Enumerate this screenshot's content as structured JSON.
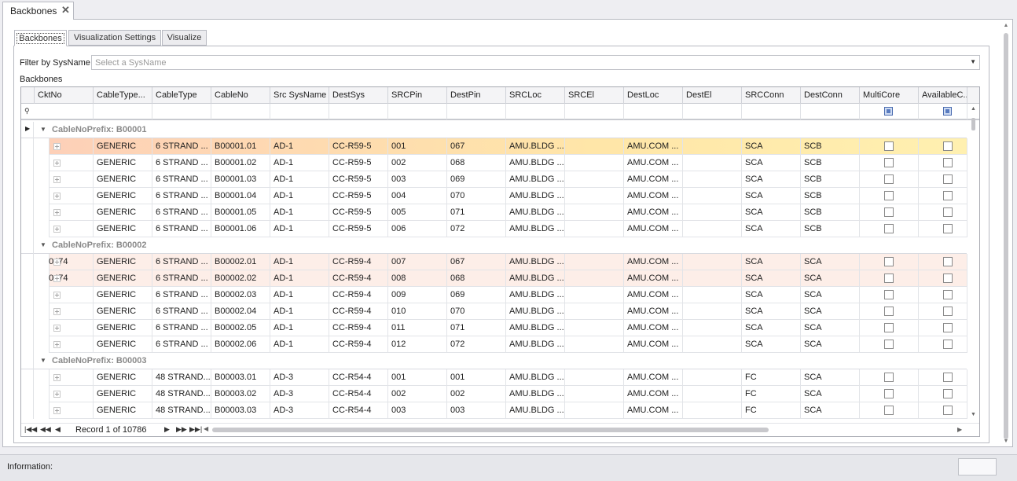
{
  "doc_tab": {
    "label": "Backbones",
    "close_glyph": "✕"
  },
  "inner_tabs": [
    {
      "label": "Backbones",
      "active": true
    },
    {
      "label": "Visualization Settings",
      "active": false
    },
    {
      "label": "Visualize",
      "active": false
    }
  ],
  "filter": {
    "label": "Filter by SysName",
    "placeholder": "Select a SysName"
  },
  "grid_caption": "Backbones",
  "columns": [
    "CktNo",
    "CableType...",
    "CableType",
    "CableNo",
    "Src SysName",
    "DestSys",
    "SRCPin",
    "DestPin",
    "SRCLoc",
    "SRCEl",
    "DestLoc",
    "DestEl",
    "SRCConn",
    "DestConn",
    "MultiCore",
    "AvailableC..."
  ],
  "groups": [
    {
      "label": "CableNoPrefix: B00001",
      "rows": [
        {
          "ckt": "",
          "ctype2": "GENERIC",
          "ctype": "6 STRAND ...",
          "cableno": "B00001.01",
          "src": "AD-1",
          "dest": "CC-R59-5",
          "srcpin": "001",
          "destpin": "067",
          "srcloc": "AMU.BLDG ...",
          "srcel": "",
          "destloc": "AMU.COM ...",
          "destel": "",
          "srcconn": "SCA",
          "destconn": "SCB",
          "state": "selected"
        },
        {
          "ckt": "",
          "ctype2": "GENERIC",
          "ctype": "6 STRAND ...",
          "cableno": "B00001.02",
          "src": "AD-1",
          "dest": "CC-R59-5",
          "srcpin": "002",
          "destpin": "068",
          "srcloc": "AMU.BLDG ...",
          "srcel": "",
          "destloc": "AMU.COM ...",
          "destel": "",
          "srcconn": "SCA",
          "destconn": "SCB",
          "state": ""
        },
        {
          "ckt": "",
          "ctype2": "GENERIC",
          "ctype": "6 STRAND ...",
          "cableno": "B00001.03",
          "src": "AD-1",
          "dest": "CC-R59-5",
          "srcpin": "003",
          "destpin": "069",
          "srcloc": "AMU.BLDG ...",
          "srcel": "",
          "destloc": "AMU.COM ...",
          "destel": "",
          "srcconn": "SCA",
          "destconn": "SCB",
          "state": ""
        },
        {
          "ckt": "",
          "ctype2": "GENERIC",
          "ctype": "6 STRAND ...",
          "cableno": "B00001.04",
          "src": "AD-1",
          "dest": "CC-R59-5",
          "srcpin": "004",
          "destpin": "070",
          "srcloc": "AMU.BLDG ...",
          "srcel": "",
          "destloc": "AMU.COM ...",
          "destel": "",
          "srcconn": "SCA",
          "destconn": "SCB",
          "state": ""
        },
        {
          "ckt": "",
          "ctype2": "GENERIC",
          "ctype": "6 STRAND ...",
          "cableno": "B00001.05",
          "src": "AD-1",
          "dest": "CC-R59-5",
          "srcpin": "005",
          "destpin": "071",
          "srcloc": "AMU.BLDG ...",
          "srcel": "",
          "destloc": "AMU.COM ...",
          "destel": "",
          "srcconn": "SCA",
          "destconn": "SCB",
          "state": ""
        },
        {
          "ckt": "",
          "ctype2": "GENERIC",
          "ctype": "6 STRAND ...",
          "cableno": "B00001.06",
          "src": "AD-1",
          "dest": "CC-R59-5",
          "srcpin": "006",
          "destpin": "072",
          "srcloc": "AMU.BLDG ...",
          "srcel": "",
          "destloc": "AMU.COM ...",
          "destel": "",
          "srcconn": "SCA",
          "destconn": "SCB",
          "state": ""
        }
      ]
    },
    {
      "label": "CableNoPrefix: B00002",
      "rows": [
        {
          "ckt": "0474",
          "ctype2": "GENERIC",
          "ctype": "6 STRAND ...",
          "cableno": "B00002.01",
          "src": "AD-1",
          "dest": "CC-R59-4",
          "srcpin": "007",
          "destpin": "067",
          "srcloc": "AMU.BLDG ...",
          "srcel": "",
          "destloc": "AMU.COM ...",
          "destel": "",
          "srcconn": "SCA",
          "destconn": "SCA",
          "state": "highlight"
        },
        {
          "ckt": "0474",
          "ctype2": "GENERIC",
          "ctype": "6 STRAND ...",
          "cableno": "B00002.02",
          "src": "AD-1",
          "dest": "CC-R59-4",
          "srcpin": "008",
          "destpin": "068",
          "srcloc": "AMU.BLDG ...",
          "srcel": "",
          "destloc": "AMU.COM ...",
          "destel": "",
          "srcconn": "SCA",
          "destconn": "SCA",
          "state": "highlight"
        },
        {
          "ckt": "",
          "ctype2": "GENERIC",
          "ctype": "6 STRAND ...",
          "cableno": "B00002.03",
          "src": "AD-1",
          "dest": "CC-R59-4",
          "srcpin": "009",
          "destpin": "069",
          "srcloc": "AMU.BLDG ...",
          "srcel": "",
          "destloc": "AMU.COM ...",
          "destel": "",
          "srcconn": "SCA",
          "destconn": "SCA",
          "state": ""
        },
        {
          "ckt": "",
          "ctype2": "GENERIC",
          "ctype": "6 STRAND ...",
          "cableno": "B00002.04",
          "src": "AD-1",
          "dest": "CC-R59-4",
          "srcpin": "010",
          "destpin": "070",
          "srcloc": "AMU.BLDG ...",
          "srcel": "",
          "destloc": "AMU.COM ...",
          "destel": "",
          "srcconn": "SCA",
          "destconn": "SCA",
          "state": ""
        },
        {
          "ckt": "",
          "ctype2": "GENERIC",
          "ctype": "6 STRAND ...",
          "cableno": "B00002.05",
          "src": "AD-1",
          "dest": "CC-R59-4",
          "srcpin": "011",
          "destpin": "071",
          "srcloc": "AMU.BLDG ...",
          "srcel": "",
          "destloc": "AMU.COM ...",
          "destel": "",
          "srcconn": "SCA",
          "destconn": "SCA",
          "state": ""
        },
        {
          "ckt": "",
          "ctype2": "GENERIC",
          "ctype": "6 STRAND ...",
          "cableno": "B00002.06",
          "src": "AD-1",
          "dest": "CC-R59-4",
          "srcpin": "012",
          "destpin": "072",
          "srcloc": "AMU.BLDG ...",
          "srcel": "",
          "destloc": "AMU.COM ...",
          "destel": "",
          "srcconn": "SCA",
          "destconn": "SCA",
          "state": ""
        }
      ]
    },
    {
      "label": "CableNoPrefix: B00003",
      "rows": [
        {
          "ckt": "",
          "ctype2": "GENERIC",
          "ctype": "48 STRAND...",
          "cableno": "B00003.01",
          "src": "AD-3",
          "dest": "CC-R54-4",
          "srcpin": "001",
          "destpin": "001",
          "srcloc": "AMU.BLDG ...",
          "srcel": "",
          "destloc": "AMU.COM ...",
          "destel": "",
          "srcconn": "FC",
          "destconn": "SCA",
          "state": ""
        },
        {
          "ckt": "",
          "ctype2": "GENERIC",
          "ctype": "48 STRAND...",
          "cableno": "B00003.02",
          "src": "AD-3",
          "dest": "CC-R54-4",
          "srcpin": "002",
          "destpin": "002",
          "srcloc": "AMU.BLDG ...",
          "srcel": "",
          "destloc": "AMU.COM ...",
          "destel": "",
          "srcconn": "FC",
          "destconn": "SCA",
          "state": ""
        },
        {
          "ckt": "",
          "ctype2": "GENERIC",
          "ctype": "48 STRAND...",
          "cableno": "B00003.03",
          "src": "AD-3",
          "dest": "CC-R54-4",
          "srcpin": "003",
          "destpin": "003",
          "srcloc": "AMU.BLDG ...",
          "srcel": "",
          "destloc": "AMU.COM ...",
          "destel": "",
          "srcconn": "FC",
          "destconn": "SCA",
          "state": ""
        }
      ]
    }
  ],
  "navigator": {
    "record_text": "Record 1 of 10786"
  },
  "status": {
    "label": "Information:"
  }
}
